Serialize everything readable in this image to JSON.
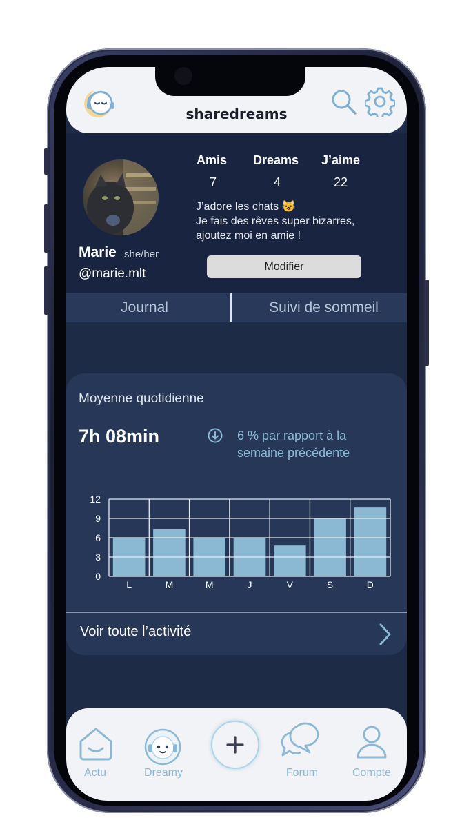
{
  "app": {
    "title": "sharedreams"
  },
  "profile": {
    "name": "Marie",
    "pronouns": "she/her",
    "handle": "@marie.mlt",
    "stats": [
      {
        "label": "Amis",
        "value": "7"
      },
      {
        "label": "Dreams",
        "value": "4"
      },
      {
        "label": "J’aime",
        "value": "22"
      }
    ],
    "bio": [
      "J’adore les chats 😺",
      "Je fais des rêves super bizarres,",
      "ajoutez moi en amie !"
    ],
    "edit_label": "Modifier"
  },
  "tabs": [
    {
      "label": "Journal"
    },
    {
      "label": "Suivi de sommeil"
    }
  ],
  "sleep": {
    "title": "Moyenne quotidienne",
    "average": "7h 08min",
    "trend_text": [
      "6 % par rapport à la",
      "semaine précédente"
    ],
    "see_all": "Voir toute l’activité"
  },
  "chart_data": {
    "type": "bar",
    "categories": [
      "L",
      "M",
      "M",
      "J",
      "V",
      "S",
      "D"
    ],
    "values": [
      6,
      7.3,
      6,
      6,
      4.8,
      9,
      10.7
    ],
    "yticks": [
      0,
      3,
      6,
      9,
      12
    ],
    "ylim": [
      0,
      12
    ],
    "grid": true,
    "bar_color": "#8bb8d3",
    "grid_color": "#e8ecf2"
  },
  "nav": [
    {
      "label": "Actu",
      "icon": "home-icon"
    },
    {
      "label": "Dreamy",
      "icon": "dreamy-avatar-icon"
    },
    {
      "label": "",
      "icon": "plus-icon"
    },
    {
      "label": "Forum",
      "icon": "forum-icon"
    },
    {
      "label": "Compte",
      "icon": "account-icon"
    }
  ],
  "colors": {
    "background": "#1e2b47",
    "accent": "#8ab8d6",
    "header": "#f2f3f6"
  }
}
